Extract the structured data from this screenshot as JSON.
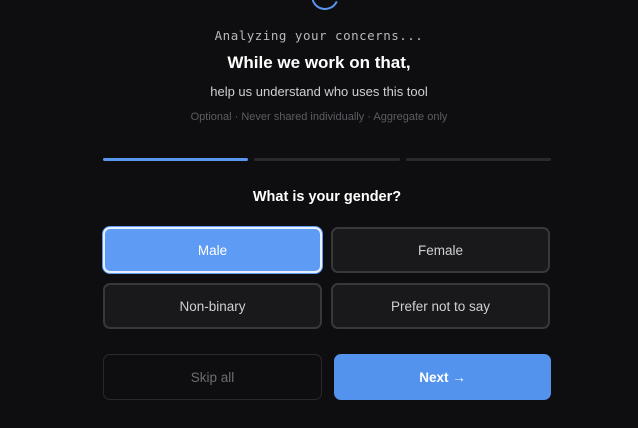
{
  "header": {
    "status": "Analyzing your concerns...",
    "title": "While we work on that,",
    "subtitle": "help us understand who uses this tool",
    "note": "Optional · Never shared individually · Aggregate only"
  },
  "progress": {
    "total_steps": 3,
    "current_step": 1
  },
  "question": {
    "text": "What is your gender?",
    "options": [
      {
        "label": "Male",
        "selected": true
      },
      {
        "label": "Female",
        "selected": false
      },
      {
        "label": "Non-binary",
        "selected": false
      },
      {
        "label": "Prefer not to say",
        "selected": false
      }
    ]
  },
  "actions": {
    "skip_label": "Skip all",
    "next_label": "Next →"
  },
  "colors": {
    "accent": "#5a96f0",
    "background": "#0e0e10"
  },
  "icons": {
    "spinner": "loading-spinner-icon"
  }
}
